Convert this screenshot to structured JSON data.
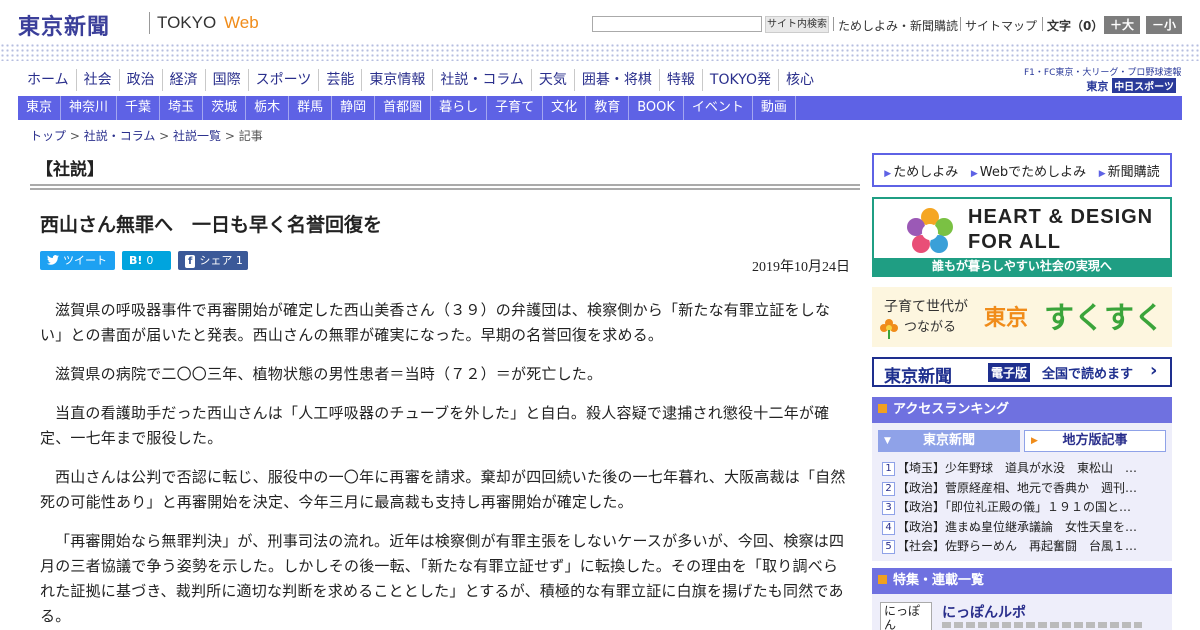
{
  "header": {
    "logo_main": "東京新聞",
    "logo_tokyo": "TOKYO",
    "logo_web": "Web",
    "search_placeholder": "",
    "search_button": "サイト内検索",
    "links": [
      "ためしよみ・新聞購読",
      "サイトマップ"
    ],
    "font_size_label": "文字（0）",
    "font_up": "＋大",
    "font_down": "－小"
  },
  "nav_primary": [
    "ホーム",
    "社会",
    "政治",
    "経済",
    "国際",
    "スポーツ",
    "芸能",
    "東京情報",
    "社説・コラム",
    "天気",
    "囲碁・将棋",
    "特報",
    "TOKYO発",
    "核心"
  ],
  "sports_logo": {
    "top": "F1・FC東京・大リーグ・プロ野球速報",
    "prefix": "東京",
    "name": "中日スポーツ"
  },
  "nav_regional": [
    "東京",
    "神奈川",
    "千葉",
    "埼玉",
    "茨城",
    "栃木",
    "群馬",
    "静岡",
    "首都圏",
    "暮らし",
    "子育て",
    "文化",
    "教育",
    "BOOK",
    "イベント",
    "動画"
  ],
  "breadcrumb": {
    "items": [
      "トップ",
      "社説・コラム",
      "社説一覧"
    ],
    "current": "記事",
    "sep": " > "
  },
  "article": {
    "section": "【社説】",
    "headline": "西山さん無罪へ　一日も早く名誉回復を",
    "share": {
      "tweet": "ツイート",
      "hatena_icon": "B!",
      "hatena_count": "0",
      "facebook_icon": "f",
      "facebook": "シェア",
      "facebook_count": "1"
    },
    "date": "2019年10月24日",
    "paragraphs": [
      "滋賀県の呼吸器事件で再審開始が確定した西山美香さん（３９）の弁護団は、検察側から「新たな有罪立証をしない」との書面が届いたと発表。西山さんの無罪が確実になった。早期の名誉回復を求める。",
      "滋賀県の病院で二〇〇三年、植物状態の男性患者＝当時（７２）＝が死亡した。",
      "当直の看護助手だった西山さんは「人工呼吸器のチューブを外した」と自白。殺人容疑で逮捕され懲役十二年が確定、一七年まで服役した。",
      "西山さんは公判で否認に転じ、服役中の一〇年に再審を請求。棄却が四回続いた後の一七年暮れ、大阪高裁は「自然死の可能性あり」と再審開始を決定、今年三月に最高裁も支持し再審開始が確定した。",
      "「再審開始なら無罪判決」が、刑事司法の流れ。近年は検察側が有罪主張をしないケースが多いが、今回、検察は四月の三者協議で争う姿勢を示した。しかしその後一転、「新たな有罪立証せず」に転換した。その理由を「取り調べられた証拠に基づき、裁判所に適切な判断を求めることとした」とするが、積極的な有罪立証に白旗を揚げたも同然である。"
    ]
  },
  "sidebar": {
    "tameshi": [
      "ためしよみ",
      "Webでためしよみ",
      "新聞購読"
    ],
    "heart": {
      "title1": "HEART & DESIGN",
      "title2": "FOR ALL",
      "bar": "誰もが暮らしやすい社会の実現へ"
    },
    "sukusuku": {
      "line1": "子育て世代が",
      "line2": "つながる",
      "tokyo": "東京",
      "main": "すくすく"
    },
    "epaper": {
      "logo": "東京新聞",
      "tag": "電子版",
      "text": "全国で読めます",
      "arrow": "›"
    },
    "ranking": {
      "title": "アクセスランキング",
      "tab_active": "東京新聞",
      "tab_inactive": "地方版記事",
      "items": [
        {
          "num": "1",
          "text": "【埼玉】少年野球　道具が水没　東松山　…"
        },
        {
          "num": "2",
          "text": "【政治】菅原経産相、地元で香典か　週刊…"
        },
        {
          "num": "3",
          "text": "【政治】「即位礼正殿の儀」１９１の国と…"
        },
        {
          "num": "4",
          "text": "【政治】進まぬ皇位継承議論　女性天皇を…"
        },
        {
          "num": "5",
          "text": "【社会】佐野らーめん　再起奮闘　台風１…"
        }
      ]
    },
    "features": {
      "title": "特集・連載一覧",
      "thumb": "にっぽん",
      "item_title": "にっぽんルポ"
    }
  },
  "colors": {
    "brand": "#3b3f9a",
    "nav_bar": "#5e62e5",
    "accent": "#f08c1a",
    "heart_green": "#1f9e83",
    "twitter": "#1da1f2",
    "hatena": "#00a4de",
    "facebook": "#3b5998"
  }
}
